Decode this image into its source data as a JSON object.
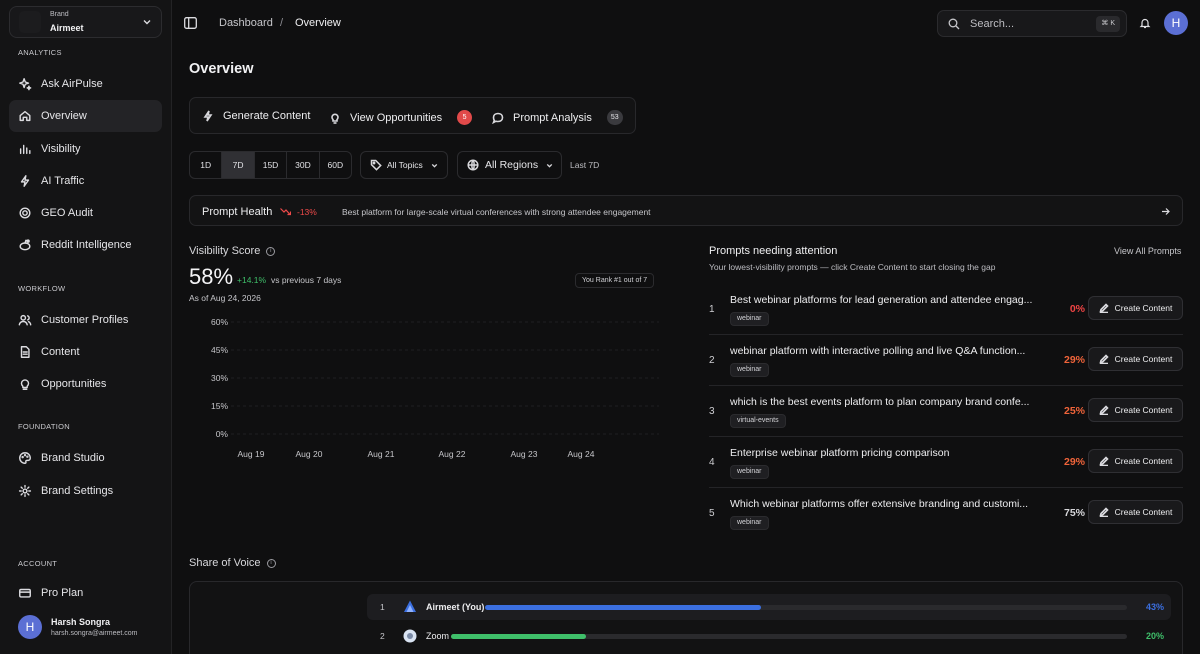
{
  "brand": {
    "label": "Brand",
    "name": "Airmeet"
  },
  "sidebar": {
    "sections": {
      "analytics": "ANALYTICS",
      "workflow": "WORKFLOW",
      "foundation": "FOUNDATION",
      "account": "ACCOUNT"
    },
    "items": [
      {
        "label": "Ask AirPulse",
        "icon": "sparkle-icon"
      },
      {
        "label": "Overview",
        "icon": "home-icon",
        "active": true
      },
      {
        "label": "Visibility",
        "icon": "bar-chart-icon"
      },
      {
        "label": "AI Traffic",
        "icon": "lightning-icon"
      },
      {
        "label": "GEO Audit",
        "icon": "target-icon"
      },
      {
        "label": "Reddit Intelligence",
        "icon": "reddit-icon"
      },
      {
        "label": "Customer Profiles",
        "icon": "users-icon"
      },
      {
        "label": "Content",
        "icon": "document-icon"
      },
      {
        "label": "Opportunities",
        "icon": "lightbulb-icon"
      },
      {
        "label": "Brand Studio",
        "icon": "palette-icon"
      },
      {
        "label": "Brand Settings",
        "icon": "gear-icon"
      },
      {
        "label": "Pro Plan",
        "icon": "card-icon"
      }
    ],
    "user": {
      "initial": "H",
      "name": "Harsh Songra",
      "email": "harsh.songra@airmeet.com"
    }
  },
  "topbar": {
    "breadcrumb": [
      "Dashboard",
      "Overview"
    ],
    "search_placeholder": "Search...",
    "shortcut": "⌘ K",
    "avatar_initial": "H"
  },
  "page": {
    "title": "Overview"
  },
  "actions": {
    "generate": "Generate Content",
    "opportunities": "View Opportunities",
    "opportunities_count": "5",
    "prompt_analysis": "Prompt Analysis",
    "prompt_count": "53"
  },
  "filters": {
    "ranges": [
      "1D",
      "7D",
      "15D",
      "30D",
      "60D"
    ],
    "selected_range": "7D",
    "topics": "All Topics",
    "regions": "All Regions",
    "period": "Last 7D"
  },
  "prompt_health": {
    "label": "Prompt Health",
    "delta": "-13%",
    "text": "Best platform for large-scale virtual conferences with strong attendee engagement"
  },
  "visibility": {
    "title": "Visibility Score",
    "score": "58%",
    "delta": "+14.1%",
    "comparison": "vs previous 7 days",
    "as_of": "As of Aug 24, 2026",
    "rank": "You Rank #1 out of 7"
  },
  "chart_data": {
    "type": "line",
    "x": [
      "Aug 19",
      "Aug 20",
      "Aug 21",
      "Aug 22",
      "Aug 23",
      "Aug 24"
    ],
    "series": [],
    "yticks": [
      "60%",
      "45%",
      "30%",
      "15%",
      "0%"
    ],
    "ylim": [
      0,
      60
    ],
    "grid": true
  },
  "prompts": {
    "title": "Prompts needing attention",
    "subtitle": "Your lowest-visibility prompts — click Create Content to start closing the gap",
    "view_all": "View All Prompts",
    "button_label": "Create Content",
    "items": [
      {
        "index": "1",
        "text": "Best webinar platforms for lead generation and attendee engag...",
        "tag": "webinar",
        "pct": "0%",
        "color": "#ef4444"
      },
      {
        "index": "2",
        "text": "webinar platform with interactive polling and live Q&A function...",
        "tag": "webinar",
        "pct": "29%",
        "color": "#f0643a"
      },
      {
        "index": "3",
        "text": "which is the best events platform to plan company brand confe...",
        "tag": "virtual-events",
        "pct": "25%",
        "color": "#f0643a"
      },
      {
        "index": "4",
        "text": "Enterprise webinar platform pricing comparison",
        "tag": "webinar",
        "pct": "29%",
        "color": "#f0643a"
      },
      {
        "index": "5",
        "text": "Which webinar platforms offer extensive branding and customi...",
        "tag": "webinar",
        "pct": "75%",
        "color": "#d6d6da"
      }
    ]
  },
  "share_of_voice": {
    "title": "Share of Voice",
    "items": [
      {
        "rank": "1",
        "name": "Airmeet (You)",
        "pct": "43%",
        "value": 43,
        "color": "#3b6fe0"
      },
      {
        "rank": "2",
        "name": "Zoom",
        "pct": "20%",
        "value": 20,
        "color": "#3fbf6a"
      }
    ]
  }
}
